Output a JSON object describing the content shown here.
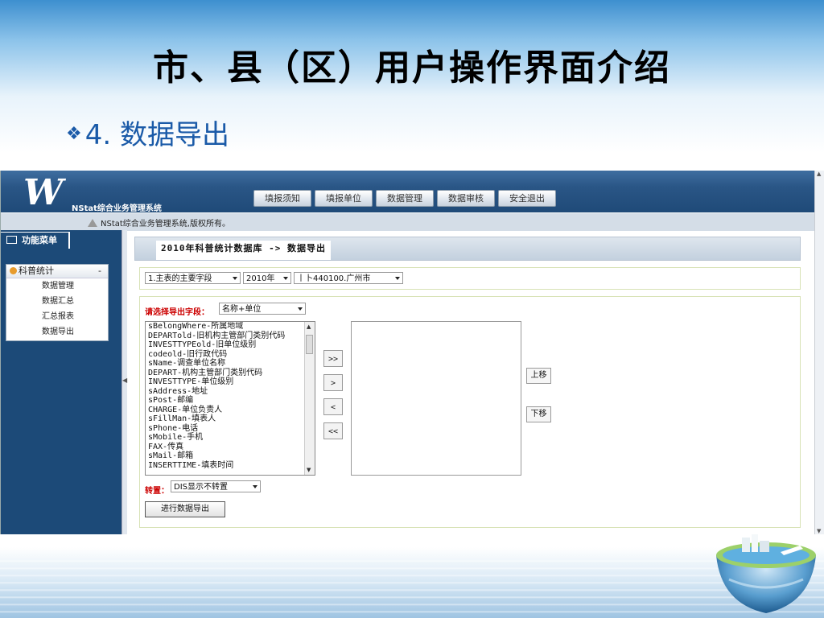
{
  "slide": {
    "title": "市、县（区）用户操作界面介绍",
    "bullet_number": "4.",
    "bullet_text": "数据导出"
  },
  "app": {
    "logo_letter": "W",
    "system_name": "NStat综合业务管理系统",
    "nav": [
      "填报须知",
      "填报单位",
      "数据管理",
      "数据审核",
      "安全退出"
    ],
    "notice": "NStat综合业务管理系统,版权所有。",
    "sidebar": {
      "header": "功能菜单",
      "group": "科普统计",
      "group_toggle": "-",
      "items": [
        "数据管理",
        "数据汇总",
        "汇总报表",
        "数据导出"
      ]
    },
    "breadcrumb": "2010年科普统计数据库 -> 数据导出",
    "filters": {
      "table": "1.主表的主要字段",
      "year": "2010年",
      "region": "丨卜440100.广州市"
    },
    "field_select": {
      "label": "请选择导出字段：",
      "value": "名称+单位"
    },
    "fields": [
      "sBelongWhere-所属地域",
      "DEPARTold-旧机构主管部门类别代码",
      "INVESTTYPEold-旧单位级别",
      "codeold-旧行政代码",
      "sName-调查单位名称",
      "DEPART-机构主管部门类别代码",
      "INVESTTYPE-单位级别",
      "sAddress-地址",
      "sPost-邮编",
      "CHARGE-单位负责人",
      "sFillMan-填表人",
      "sPhone-电话",
      "sMobile-手机",
      "FAX-传真",
      "sMail-邮箱",
      "INSERTTIME-填表时间"
    ],
    "transfer_buttons": [
      ">>",
      ">",
      "<",
      "<<"
    ],
    "move_up": "上移",
    "move_down": "下移",
    "transpose": {
      "label": "转置：",
      "value": "DIS显示不转置"
    },
    "export_button": "进行数据导出"
  }
}
